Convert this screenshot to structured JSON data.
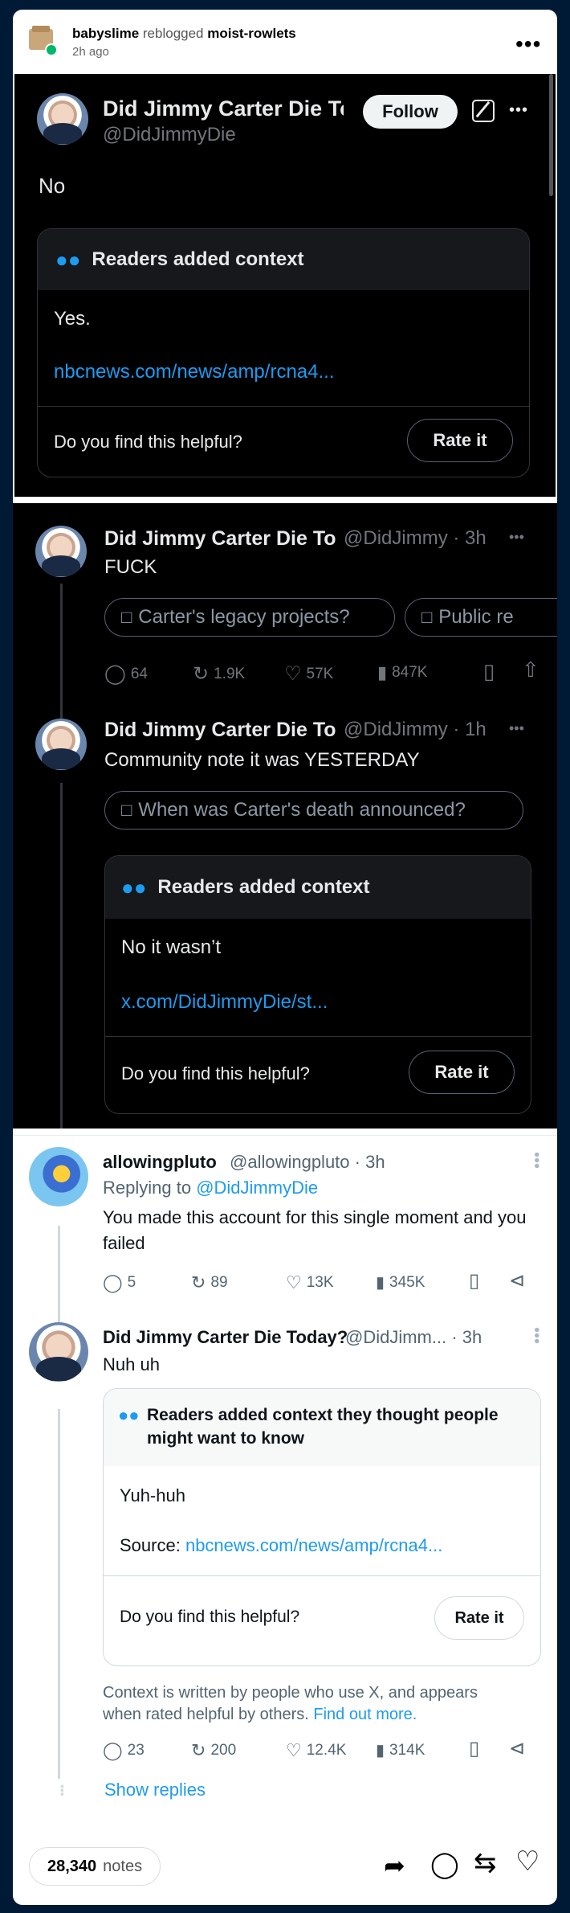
{
  "tumblr": {
    "reblogger": "babyslime",
    "reblogged_text": "reblogged",
    "source": "moist-rowlets",
    "time": "2h ago",
    "notes_count": "28,340",
    "notes_label": "notes"
  },
  "tweet1": {
    "name": "Did Jimmy Carter Die Tod",
    "handle": "@DidJimmyDie",
    "follow": "Follow",
    "text": "No",
    "context_title": "Readers added context",
    "context_text": "Yes.",
    "context_link": "nbcnews.com/news/amp/rcna4...",
    "helpful_q": "Do you find this helpful?",
    "rate": "Rate it"
  },
  "tweet2": {
    "name": "Did Jimmy Carter Die To",
    "handle": "@DidJimmy · 3h",
    "text": "FUCK",
    "chip1": "Carter's legacy projects?",
    "chip2": "Public re",
    "replies": "64",
    "retweets": "1.9K",
    "likes": "57K",
    "views": "847K"
  },
  "tweet3": {
    "name": "Did Jimmy Carter Die To",
    "handle": "@DidJimmy · 1h",
    "text": "Community note it was YESTERDAY",
    "chip": "When was Carter's death announced?",
    "context_title": "Readers added context",
    "context_text": "No it wasn’t",
    "context_link": "x.com/DidJimmyDie/st...",
    "helpful_q": "Do you find this helpful?",
    "rate": "Rate it"
  },
  "tweet4": {
    "name": "allowingpluto",
    "handle": "@allowingpluto · 3h",
    "replying_prefix": "Replying to",
    "replying_to": "@DidJimmyDie",
    "text": "You made this account for this single moment and you failed",
    "replies": "5",
    "retweets": "89",
    "likes": "13K",
    "views": "345K"
  },
  "tweet5": {
    "name": "Did Jimmy Carter Die Today?",
    "handle": "@DidJimm... · 3h",
    "text": "Nuh uh",
    "context_title": "Readers added context they thought people might want to know",
    "context_text": "Yuh-huh",
    "source_label": "Source:",
    "source_link": "nbcnews.com/news/amp/rcna4...",
    "helpful_q": "Do you find this helpful?",
    "rate": "Rate it",
    "disclaimer": "Context is written by people who use X, and appears when rated helpful by others.",
    "find_out": "Find out more.",
    "replies": "23",
    "retweets": "200",
    "likes": "12.4K",
    "views": "314K",
    "show_replies": "Show replies"
  },
  "colors": {
    "tumblr_bg": "#001935",
    "x_blue": "#1d9bf0",
    "note_blue": "#1d9bf0"
  }
}
